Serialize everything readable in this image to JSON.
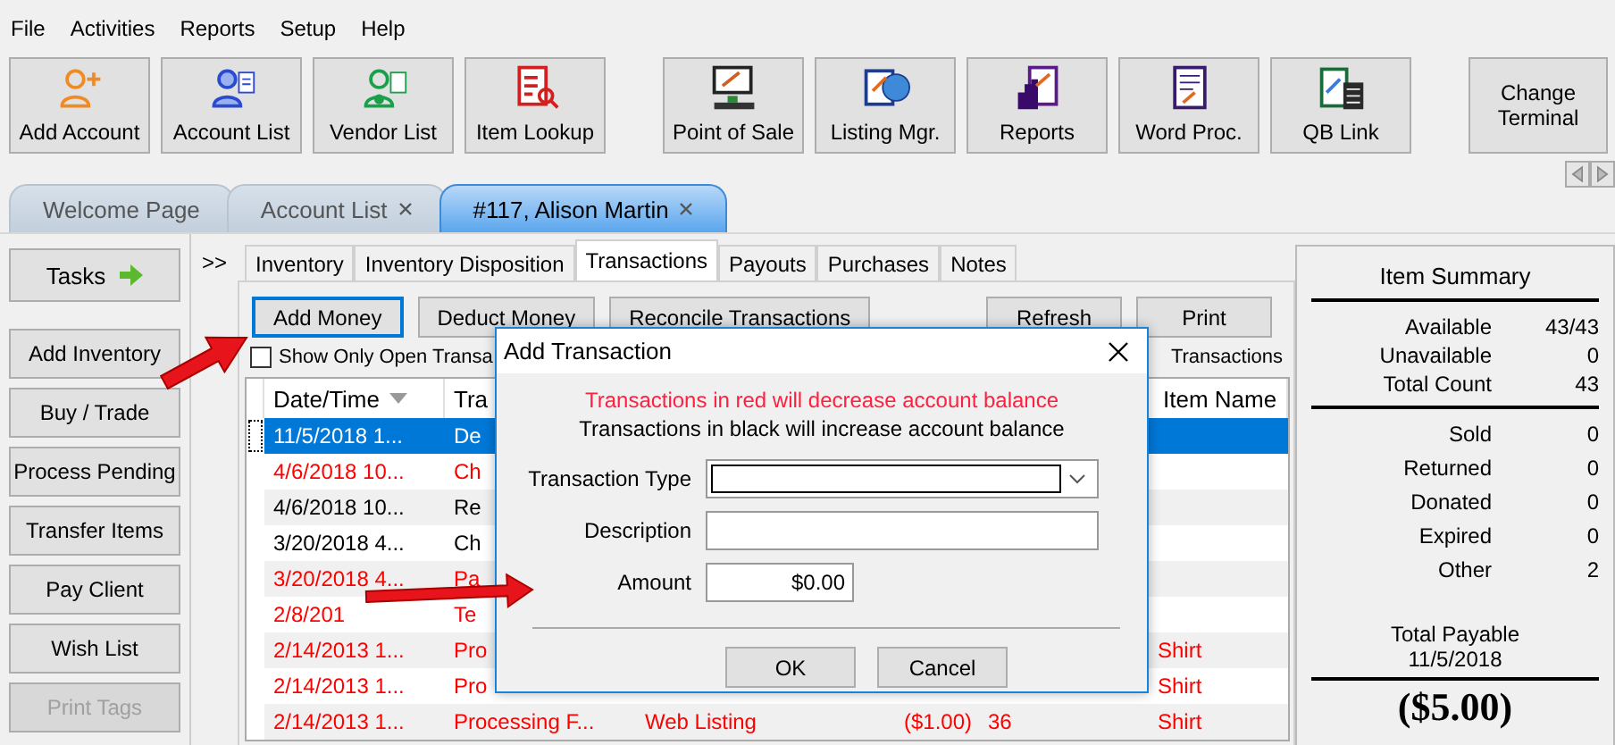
{
  "menu": [
    "File",
    "Activities",
    "Reports",
    "Setup",
    "Help"
  ],
  "toolbar": [
    {
      "label": "Add Account"
    },
    {
      "label": "Account List"
    },
    {
      "label": "Vendor List"
    },
    {
      "label": "Item Lookup"
    },
    {
      "label": "Point of Sale"
    },
    {
      "label": "Listing Mgr."
    },
    {
      "label": "Reports"
    },
    {
      "label": "Word Proc."
    },
    {
      "label": "QB Link"
    }
  ],
  "change_terminal": "Change Terminal",
  "doc_tabs": [
    {
      "label": "Welcome Page",
      "closable": false,
      "selected": false
    },
    {
      "label": "Account List",
      "closable": true,
      "selected": false
    },
    {
      "label": "#117, Alison Martin",
      "closable": true,
      "selected": true
    }
  ],
  "sidebar": [
    {
      "label": "Tasks",
      "disabled": false
    },
    {
      "label": "Add Inventory",
      "disabled": false
    },
    {
      "label": "Buy / Trade",
      "disabled": false
    },
    {
      "label": "Process Pending",
      "disabled": false
    },
    {
      "label": "Transfer Items",
      "disabled": false
    },
    {
      "label": "Pay Client",
      "disabled": false
    },
    {
      "label": "Wish List",
      "disabled": false
    },
    {
      "label": "Print Tags",
      "disabled": true
    }
  ],
  "expander": ">>",
  "sub_tabs": [
    {
      "label": "Inventory",
      "selected": false
    },
    {
      "label": "Inventory Disposition",
      "selected": false
    },
    {
      "label": "Transactions",
      "selected": true
    },
    {
      "label": "Payouts",
      "selected": false
    },
    {
      "label": "Purchases",
      "selected": false
    },
    {
      "label": "Notes",
      "selected": false
    }
  ],
  "action_buttons": [
    {
      "label": "Add Money",
      "focused": true
    },
    {
      "label": "Deduct Money",
      "focused": false
    },
    {
      "label": "Reconcile Transactions",
      "focused": false
    }
  ],
  "right_buttons": [
    "Refresh",
    "Print"
  ],
  "open_checkbox": {
    "label": "Show Only Open Transa",
    "checked": false
  },
  "transactions_label": "Transactions",
  "table": {
    "columns": [
      "Date/Time",
      "Tra",
      "",
      "",
      "",
      "Item Name"
    ],
    "rows": [
      {
        "date": "11/5/2018 1...",
        "type": "De",
        "selected": true
      },
      {
        "date": "4/6/2018 10...",
        "type": "Ch",
        "selected": false,
        "color": "#ff0000"
      },
      {
        "date": "4/6/2018 10...",
        "type": "Re",
        "selected": false,
        "color": "#000000"
      },
      {
        "date": "3/20/2018 4...",
        "type": "Ch",
        "selected": false,
        "color": "#000000"
      },
      {
        "date": "3/20/2018 4...",
        "type": "Pa",
        "selected": false,
        "color": "#ff0000"
      },
      {
        "date": "2/8/201",
        "type": "Te",
        "selected": false,
        "color": "#ff0000"
      },
      {
        "date": "2/14/2013 1...",
        "type": "Pro",
        "item": "Shirt",
        "selected": false,
        "color": "#ff0000"
      },
      {
        "date": "2/14/2013 1...",
        "type": "Pro",
        "item": "Shirt",
        "selected": false,
        "color": "#ff0000"
      },
      {
        "date": "2/14/2013 1...",
        "type": "Processing F...",
        "description": "Web Listing",
        "amount": "($1.00)",
        "number": "36",
        "item": "Shirt",
        "selected": false,
        "color": "#ff0000"
      }
    ]
  },
  "dialog": {
    "title": "Add Transaction",
    "note_red": "Transactions in red will decrease account balance",
    "note_black": "Transactions in black will increase account balance",
    "fields": [
      {
        "label": "Transaction Type",
        "kind": "select"
      },
      {
        "label": "Description",
        "kind": "text"
      },
      {
        "label": "Amount",
        "kind": "text",
        "value": "$0.00"
      }
    ],
    "buttons": [
      "OK",
      "Cancel"
    ]
  },
  "summary": {
    "title": "Item Summary",
    "group1": [
      {
        "label": "Available",
        "value": "43/43"
      },
      {
        "label": "Unavailable",
        "value": "0"
      },
      {
        "label": "Total Count",
        "value": "43"
      }
    ],
    "group2": [
      {
        "label": "Sold",
        "value": "0"
      },
      {
        "label": "Returned",
        "value": "0"
      },
      {
        "label": "Donated",
        "value": "0"
      },
      {
        "label": "Expired",
        "value": "0"
      },
      {
        "label": "Other",
        "value": "2"
      }
    ],
    "payable_label": "Total Payable",
    "payable_date": "11/5/2018",
    "payable_amount": "($5.00)"
  }
}
